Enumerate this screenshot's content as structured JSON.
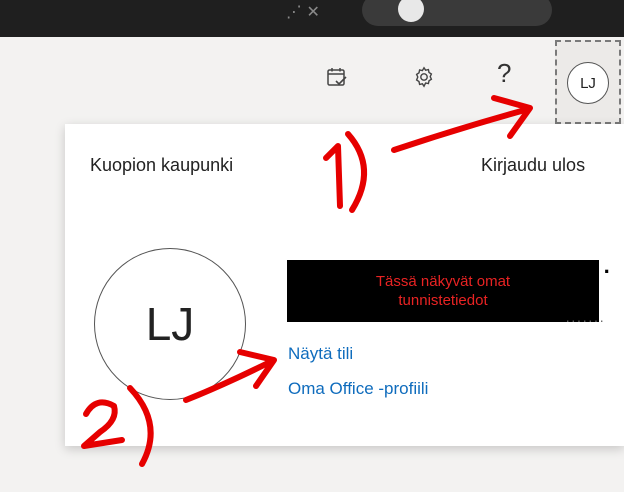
{
  "topbar": {
    "ghost_chars": "⋰ ✕"
  },
  "header": {
    "calendar_icon": "calendar-check-icon",
    "settings_icon": "gear-icon",
    "help_label": "?",
    "account_initials": "LJ"
  },
  "panel": {
    "organization": "Kuopion kaupunki",
    "sign_out": "Kirjaudu ulos",
    "avatar_initials": "LJ",
    "redaction_note": "Tässä näkyvät omat tunnistetiedot",
    "view_account": "Näytä tili",
    "office_profile": "Oma Office -profiili"
  },
  "annotations": {
    "step1": "1)",
    "step2": "2)",
    "color": "#e60000"
  }
}
